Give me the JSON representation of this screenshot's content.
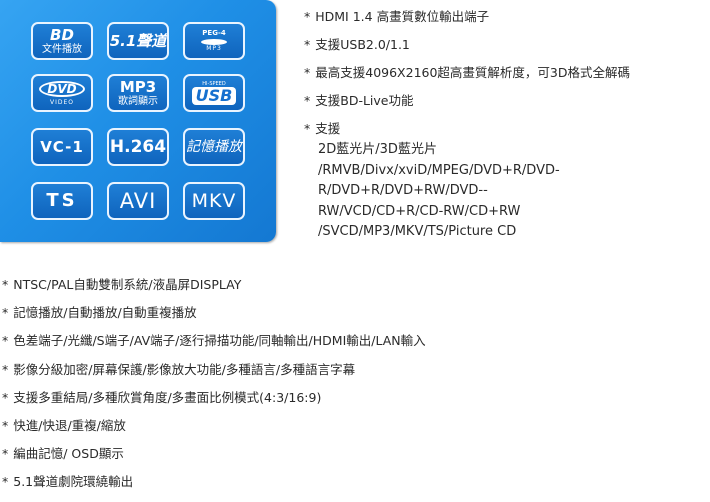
{
  "panel": {
    "tiles": [
      {
        "id": "bd",
        "big": "BD",
        "small": "文件播放"
      },
      {
        "id": "dolby",
        "big": "5.1聲道"
      },
      {
        "id": "mpeg4",
        "top": "PEG-4",
        "bottom": "MP3"
      },
      {
        "id": "dvd",
        "oval": "DVD",
        "tiny": "VIDEO"
      },
      {
        "id": "mp3",
        "big": "MP3",
        "small": "歌詞顯示"
      },
      {
        "id": "usb",
        "top": "HI-SPEED",
        "big": "USB"
      },
      {
        "id": "vc1",
        "big": "VC-1"
      },
      {
        "id": "h264",
        "big": "H.264"
      },
      {
        "id": "memory",
        "big": "記憶播放"
      },
      {
        "id": "ts",
        "big": "TS"
      },
      {
        "id": "avi",
        "big": "AVI"
      },
      {
        "id": "mkv",
        "big": "MKV"
      }
    ]
  },
  "bullet": "*",
  "right_features": [
    "HDMI 1.4 高畫質數位輸出端子",
    "支援USB2.0/1.1",
    "最高支援4096X2160超高畫質解析度，可3D格式全解碼",
    "支援BD-Live功能"
  ],
  "support": {
    "label": "支援",
    "lines": [
      "2D藍光片/3D藍光片",
      "/RMVB/Divx/xviD/MPEG/DVD+R/DVD-",
      "R/DVD+R/DVD+RW/DVD--",
      "RW/VCD/CD+R/CD-RW/CD+RW",
      "/SVCD/MP3/MKV/TS/Picture CD"
    ]
  },
  "bottom_features": [
    "NTSC/PAL自動雙制系統/液晶屏DISPLAY",
    "記憶播放/自動播放/自動重複播放",
    "色差端子/光纖/S端子/AV端子/逐行掃描功能/同軸輸出/HDMI輸出/LAN輸入",
    "影像分級加密/屏幕保護/影像放大功能/多種語言/多種語言字幕",
    "支援多重結局/多種欣賞角度/多畫面比例模式(4:3/16:9)",
    "快進/快退/重複/縮放",
    "編曲記憶/ OSD顯示",
    "5.1聲道劇院環繞輸出"
  ]
}
